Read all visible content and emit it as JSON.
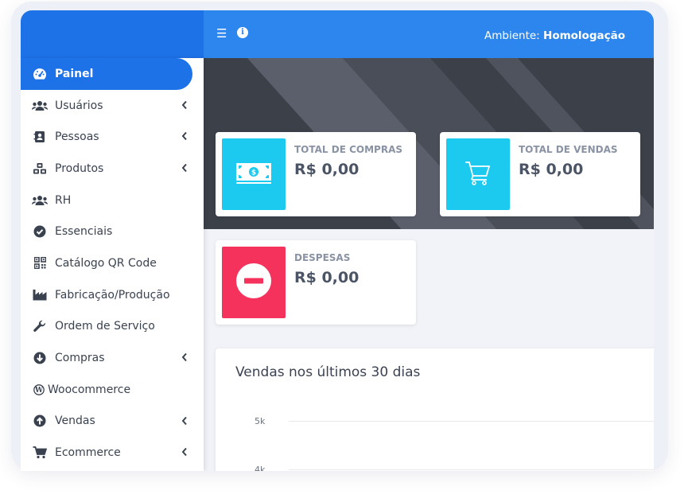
{
  "topbar": {
    "env_label": "Ambiente:",
    "env_value": "Homologação",
    "menu_icon": "hamburger-icon",
    "info_icon": "info-circle-icon"
  },
  "sidebar": {
    "items": [
      {
        "label": "Painel",
        "icon": "dashboard-gauge-icon",
        "active": true,
        "has_submenu": false
      },
      {
        "label": "Usuários",
        "icon": "users-icon",
        "has_submenu": true
      },
      {
        "label": "Pessoas",
        "icon": "contact-book-icon",
        "has_submenu": true
      },
      {
        "label": "Produtos",
        "icon": "cubes-icon",
        "has_submenu": true
      },
      {
        "label": "RH",
        "icon": "users-icon",
        "has_submenu": false
      },
      {
        "label": "Essenciais",
        "icon": "check-circle-icon",
        "has_submenu": false
      },
      {
        "label": "Catálogo QR Code",
        "icon": "qrcode-icon",
        "has_submenu": false
      },
      {
        "label": "Fabricação/Produção",
        "icon": "industry-icon",
        "has_submenu": false
      },
      {
        "label": "Ordem de Serviço",
        "icon": "wrench-icon",
        "has_submenu": false
      },
      {
        "label": "Compras",
        "icon": "arrow-down-circle-icon",
        "has_submenu": true
      },
      {
        "label": "Woocommerce",
        "icon": "wordpress-icon",
        "has_submenu": false
      },
      {
        "label": "Vendas",
        "icon": "arrow-up-circle-icon",
        "has_submenu": true
      },
      {
        "label": "Ecommerce",
        "icon": "shopping-cart-icon",
        "has_submenu": true
      }
    ]
  },
  "cards": [
    {
      "label": "TOTAL DE COMPRAS",
      "value": "R$ 0,00",
      "icon": "money-bill-icon",
      "color": "#1ccaf0"
    },
    {
      "label": "TOTAL DE VENDAS",
      "value": "R$ 0,00",
      "icon": "shopping-cart-icon",
      "color": "#1ccaf0"
    },
    {
      "label": "DESPESAS",
      "value": "R$ 0,00",
      "icon": "minus-circle-icon",
      "color": "#f5325c"
    }
  ],
  "chart": {
    "title": "Vendas nos últimos 30 dias",
    "ticks": [
      "5k",
      "4k"
    ]
  },
  "colors": {
    "primary": "#1e72e8",
    "topbar": "#2d86ee",
    "cyan": "#1ccaf0",
    "red": "#f5325c"
  }
}
